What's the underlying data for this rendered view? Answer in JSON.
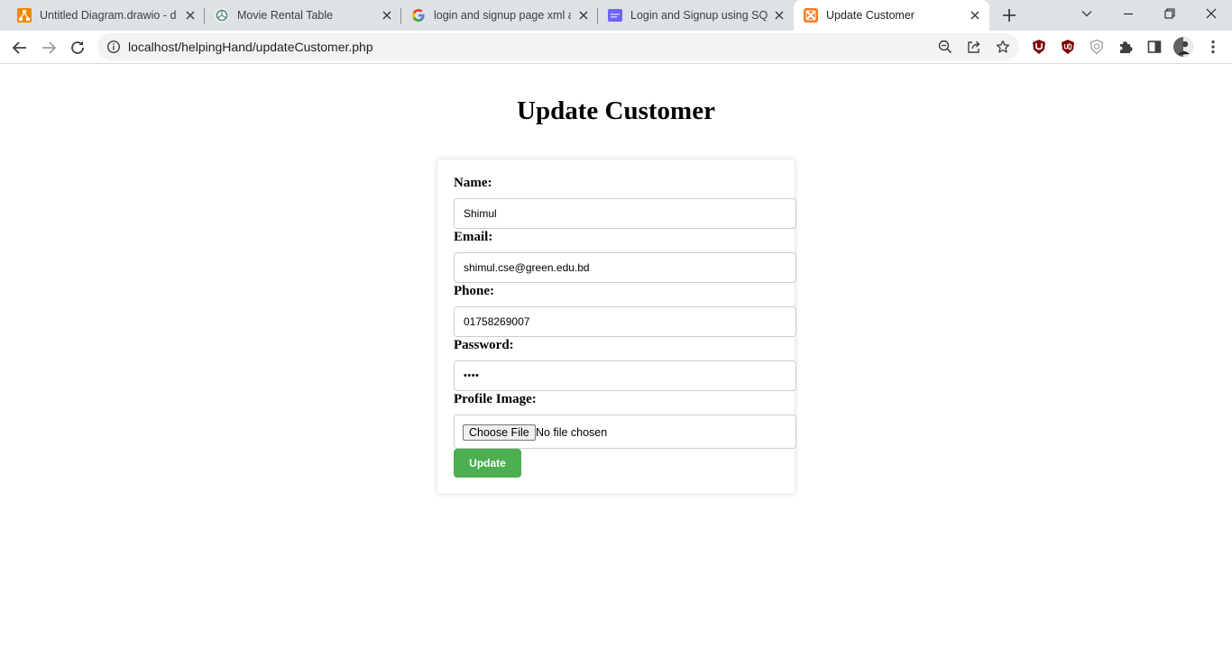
{
  "browser": {
    "tabs": [
      {
        "title": "Untitled Diagram.drawio - dr",
        "icon": "drawio-icon",
        "active": false
      },
      {
        "title": "Movie Rental Table",
        "icon": "chatgpt-icon",
        "active": false
      },
      {
        "title": "login and signup page xml ar",
        "icon": "google-icon",
        "active": false
      },
      {
        "title": "Login and Signup using SQLit",
        "icon": "site-icon",
        "active": false
      },
      {
        "title": "Update Customer",
        "icon": "xampp-icon",
        "active": true
      }
    ],
    "url": "localhost/helpingHand/updateCustomer.php",
    "accent_color": "#1a73e8"
  },
  "page": {
    "title": "Update Customer",
    "form": {
      "name_label": "Name:",
      "name_value": "Shimul",
      "email_label": "Email:",
      "email_value": "shimul.cse@green.edu.bd",
      "phone_label": "Phone:",
      "phone_value": "01758269007",
      "password_label": "Password:",
      "password_value": "••••",
      "image_label": "Profile Image:",
      "file_button_label": "Choose File",
      "file_status": "No file chosen",
      "submit_label": "Update",
      "submit_color": "#4caf50"
    }
  }
}
